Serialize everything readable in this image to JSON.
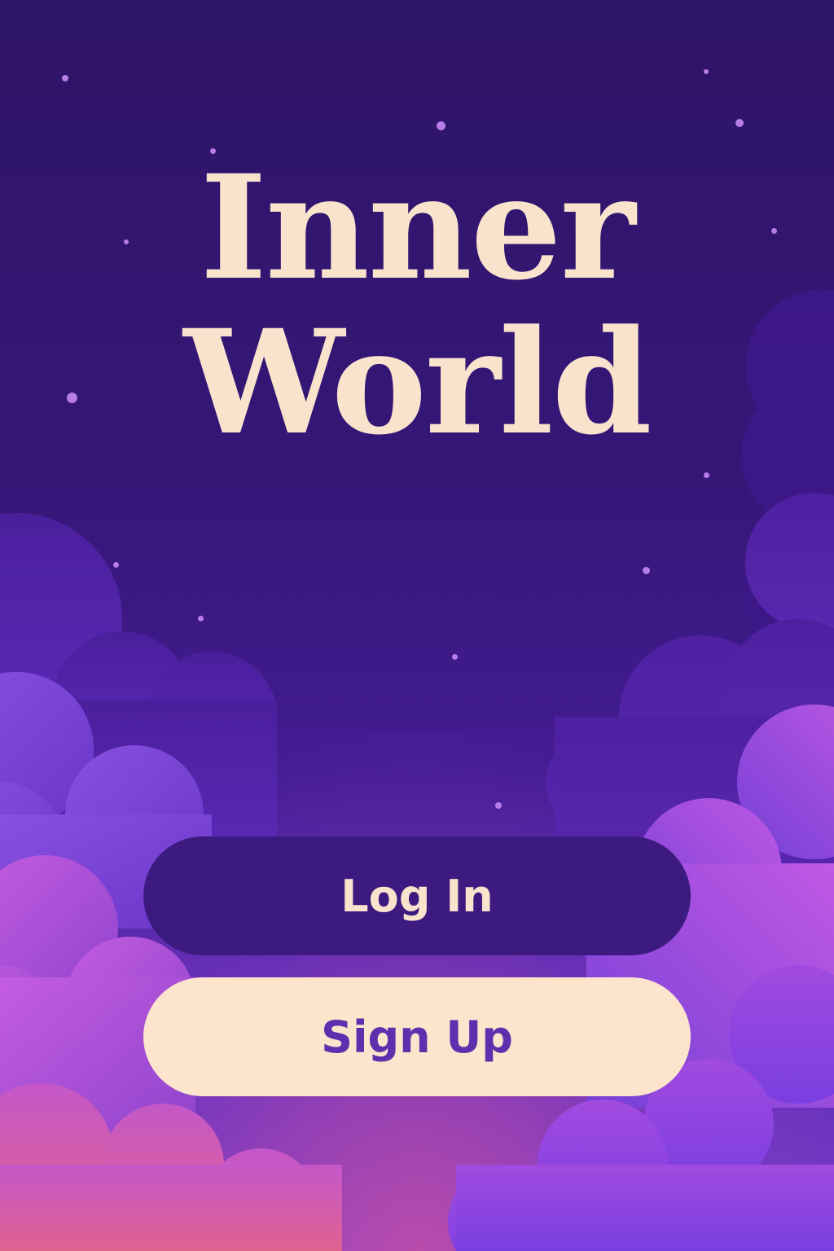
{
  "app": {
    "title_line_1": "Inner",
    "title_line_2": "World"
  },
  "actions": {
    "login_label": "Log In",
    "signup_label": "Sign Up"
  },
  "colors": {
    "background_top": "#2e1467",
    "background_bottom": "#7b3cc8",
    "title_text": "#fae3cc",
    "login_button_bg": "#3c1a80",
    "login_button_text": "#fae3cc",
    "signup_button_bg": "#fde4cc",
    "signup_button_text": "#5f2fae",
    "star": "#b77ce8",
    "cloud_pink": "#c354d8",
    "cloud_violet": "#7a43d4"
  }
}
